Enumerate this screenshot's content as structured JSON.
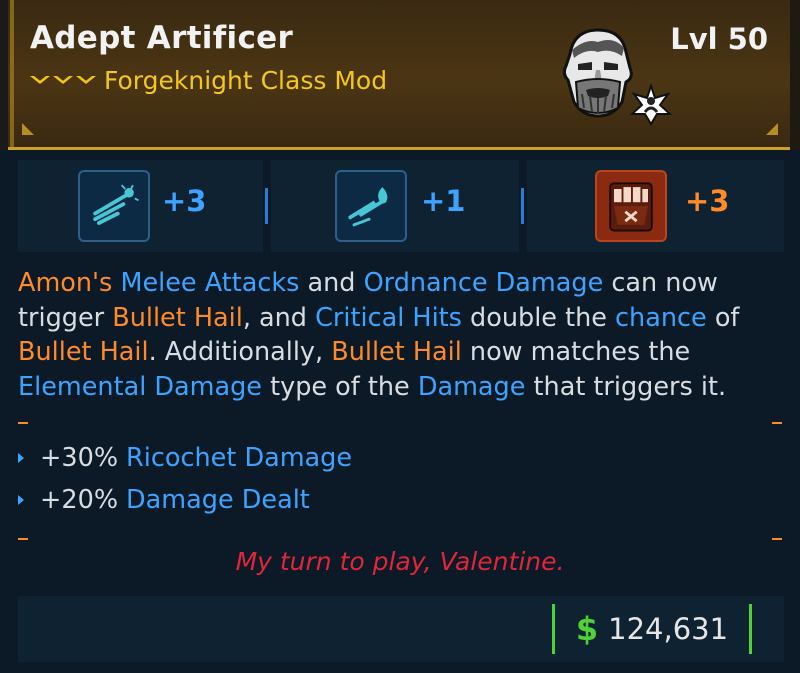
{
  "item": {
    "name": "Adept Artificer",
    "subtitle": "Forgeknight Class Mod",
    "level": "Lvl 50",
    "rarity_color": "#f0c419"
  },
  "skills": [
    {
      "icon": "throw-weapon-skill-icon",
      "value": "+3",
      "color": "#3ea3ff"
    },
    {
      "icon": "flame-slash-skill-icon",
      "value": "+1",
      "color": "#3ea3ff"
    },
    {
      "icon": "fist-skill-icon",
      "value": "+3",
      "color": "#ff8a2a"
    }
  ],
  "description": {
    "t1": "Amon's",
    "t2": " ",
    "t3": "Melee Attacks",
    "t4": " and ",
    "t5": "Ordnance Damage",
    "t6": " can now trigger ",
    "t7": "Bullet Hail",
    "t8": ", and ",
    "t9": "Critical Hits",
    "t10": " double the ",
    "t11": "chance",
    "t12": " of ",
    "t13": "Bullet Hail",
    "t14": ". Additionally, ",
    "t15": "Bullet Hail",
    "t16": " now matches the ",
    "t17": "Elemental Damage",
    "t18": " type of the ",
    "t19": "Damage",
    "t20": " that triggers it."
  },
  "stats": [
    {
      "value": "+30%",
      "label": "Ricochet Damage"
    },
    {
      "value": "+20%",
      "label": "Damage Dealt"
    }
  ],
  "flavor_text": "My turn to play, Valentine.",
  "price": {
    "currency_symbol": "$",
    "amount": "124,631"
  }
}
